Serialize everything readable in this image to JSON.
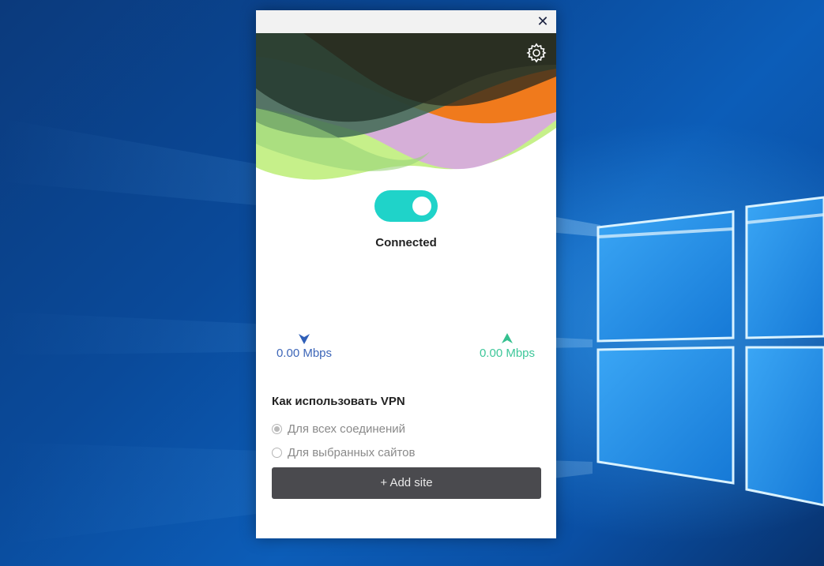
{
  "window": {
    "close_label": "✕"
  },
  "vpn": {
    "connected": true,
    "status": "Connected",
    "toggle_color": "#1fd3c9"
  },
  "speeds": {
    "download": "0.00 Mbps",
    "upload": "0.00 Mbps",
    "download_color": "#3d66b8",
    "upload_color": "#3ec79a"
  },
  "usage": {
    "title": "Как использовать VPN",
    "options": [
      {
        "label": "Для всех соединений",
        "selected": true
      },
      {
        "label": "Для выбранных сайтов",
        "selected": false
      }
    ],
    "add_site_label": "+ Add site"
  },
  "icons": {
    "close": "close-icon",
    "settings": "gear-icon",
    "download": "arrow-down-icon",
    "upload": "arrow-up-icon"
  }
}
